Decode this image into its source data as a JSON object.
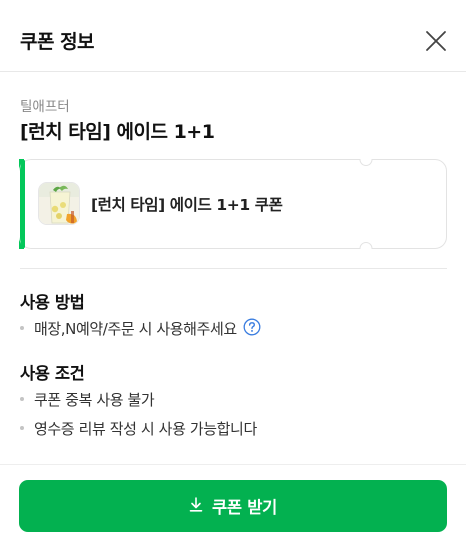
{
  "header": {
    "title": "쿠폰 정보",
    "close_icon": "close-icon"
  },
  "coupon": {
    "store_name": "틸애프터",
    "title": "[런치 타임] 에이드 1+1",
    "card_label": "[런치 타임] 에이드 1+1 쿠폰",
    "accent_color": "#03c75a",
    "thumbnail_icon": "lemon-ade-drink-image"
  },
  "usage_method": {
    "title": "사용 방법",
    "items": [
      "매장,N예약/주문 시 사용해주세요"
    ],
    "help_icon": "question-circle-icon"
  },
  "usage_conditions": {
    "title": "사용 조건",
    "items": [
      "쿠폰 중복 사용 불가",
      "영수증 리뷰 작성 시 사용 가능합니다"
    ]
  },
  "footer": {
    "download_label": "쿠폰 받기",
    "download_icon": "download-icon",
    "button_color": "#03b150"
  }
}
